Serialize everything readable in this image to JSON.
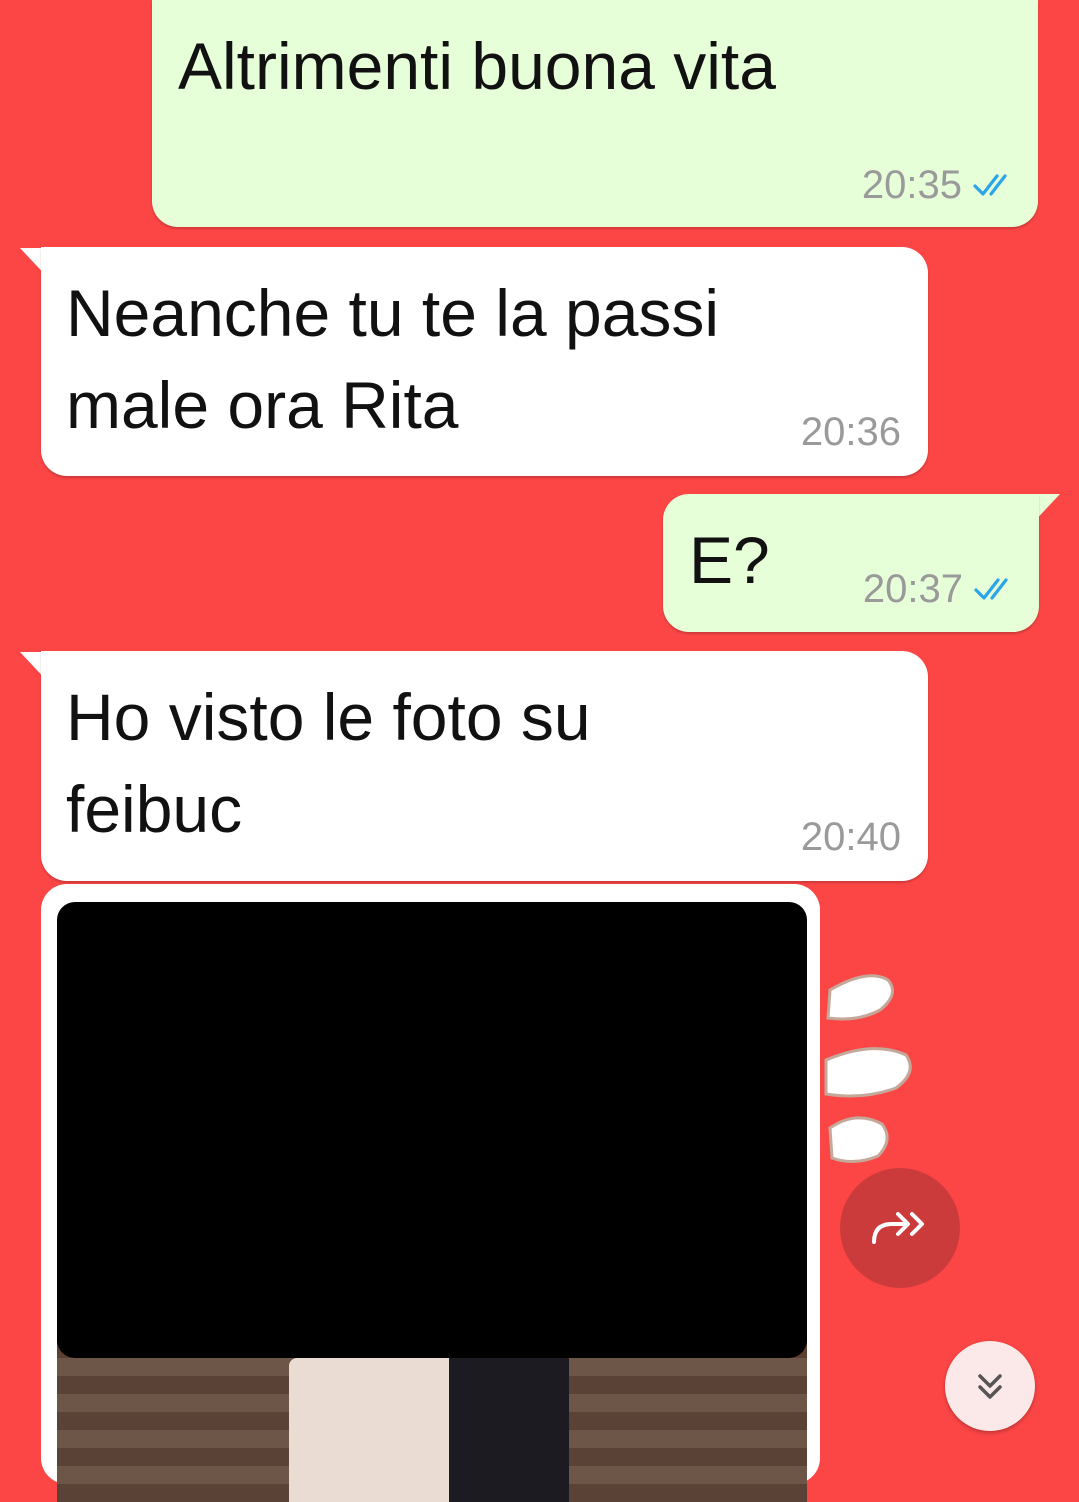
{
  "chat": {
    "messages": [
      {
        "direction": "out",
        "text": "Altrimenti buona vita",
        "time": "20:35",
        "status": "read"
      },
      {
        "direction": "in",
        "text": "Neanche tu te la passi\nmale ora Rita",
        "time": "20:36"
      },
      {
        "direction": "out",
        "text": "E?",
        "time": "20:37",
        "status": "read"
      },
      {
        "direction": "in",
        "text": "Ho visto le foto su\nfeibuc",
        "time": "20:40"
      }
    ]
  },
  "image_message": {
    "direction": "in",
    "censored": true
  },
  "buttons": {
    "forward_icon": "forward-icon",
    "scroll_down_icon": "double-chevron-down-icon"
  },
  "colors": {
    "chat_background": "#fc4646",
    "outgoing_bubble": "#e6ffd9",
    "incoming_bubble": "#ffffff",
    "read_ticks": "#2aa5e8",
    "timestamp": "#9a9a9a"
  }
}
